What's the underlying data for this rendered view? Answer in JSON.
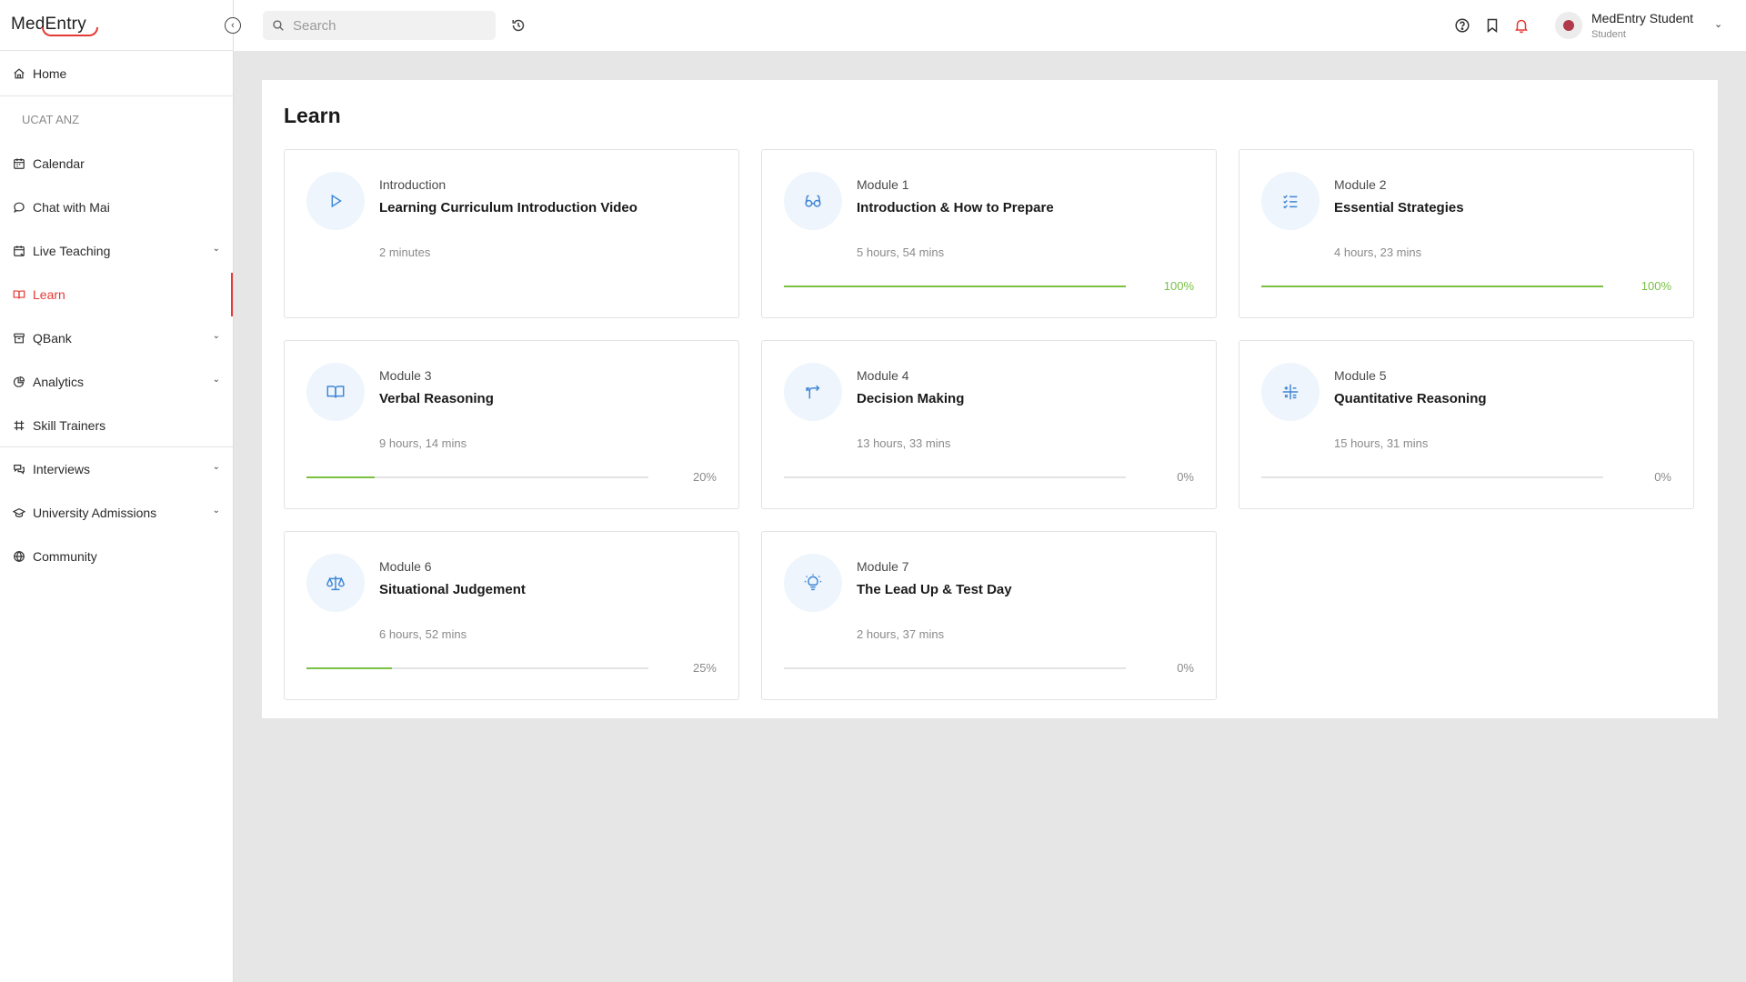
{
  "brand": {
    "logo_text": "MedEntry",
    "accent": "#e53935"
  },
  "sidebar": {
    "home": "Home",
    "section_label": "UCAT ANZ",
    "items": [
      {
        "label": "Calendar",
        "icon": "calendar-icon",
        "chevron": false
      },
      {
        "label": "Chat with Mai",
        "icon": "chat-icon",
        "chevron": false
      },
      {
        "label": "Live Teaching",
        "icon": "live-teaching-icon",
        "chevron": true
      },
      {
        "label": "Learn",
        "icon": "book-icon",
        "chevron": false,
        "active": true
      },
      {
        "label": "QBank",
        "icon": "qbank-icon",
        "chevron": true
      },
      {
        "label": "Analytics",
        "icon": "analytics-icon",
        "chevron": true
      },
      {
        "label": "Skill Trainers",
        "icon": "skill-trainers-icon",
        "chevron": false
      }
    ],
    "items2": [
      {
        "label": "Interviews",
        "icon": "interviews-icon",
        "chevron": true
      },
      {
        "label": "University Admissions",
        "icon": "graduation-cap-icon",
        "chevron": true
      },
      {
        "label": "Community",
        "icon": "globe-icon",
        "chevron": false
      }
    ]
  },
  "topbar": {
    "search_placeholder": "Search",
    "user": {
      "name": "MedEntry Student",
      "role": "Student"
    }
  },
  "main": {
    "title": "Learn",
    "progress_color": "#7ac143",
    "cards": [
      {
        "kicker": "Introduction",
        "title": "Learning Curriculum Introduction Video",
        "duration": "2 minutes",
        "icon": "play-icon",
        "progress": null,
        "progress_label": ""
      },
      {
        "kicker": "Module 1",
        "title": "Introduction & How to Prepare",
        "duration": "5 hours, 54 mins",
        "icon": "glasses-icon",
        "progress": 100,
        "progress_label": "100%"
      },
      {
        "kicker": "Module 2",
        "title": "Essential Strategies",
        "duration": "4 hours, 23 mins",
        "icon": "checklist-icon",
        "progress": 100,
        "progress_label": "100%"
      },
      {
        "kicker": "Module 3",
        "title": "Verbal Reasoning",
        "duration": "9 hours, 14 mins",
        "icon": "open-book-icon",
        "progress": 20,
        "progress_label": "20%"
      },
      {
        "kicker": "Module 4",
        "title": "Decision Making",
        "duration": "13 hours, 33 mins",
        "icon": "split-arrow-icon",
        "progress": 0,
        "progress_label": "0%"
      },
      {
        "kicker": "Module 5",
        "title": "Quantitative Reasoning",
        "duration": "15 hours, 31 mins",
        "icon": "calculator-icon",
        "progress": 0,
        "progress_label": "0%"
      },
      {
        "kicker": "Module 6",
        "title": "Situational Judgement",
        "duration": "6 hours, 52 mins",
        "icon": "scales-icon",
        "progress": 25,
        "progress_label": "25%"
      },
      {
        "kicker": "Module 7",
        "title": "The Lead Up & Test Day",
        "duration": "2 hours, 37 mins",
        "icon": "lightbulb-icon",
        "progress": 0,
        "progress_label": "0%"
      }
    ]
  }
}
